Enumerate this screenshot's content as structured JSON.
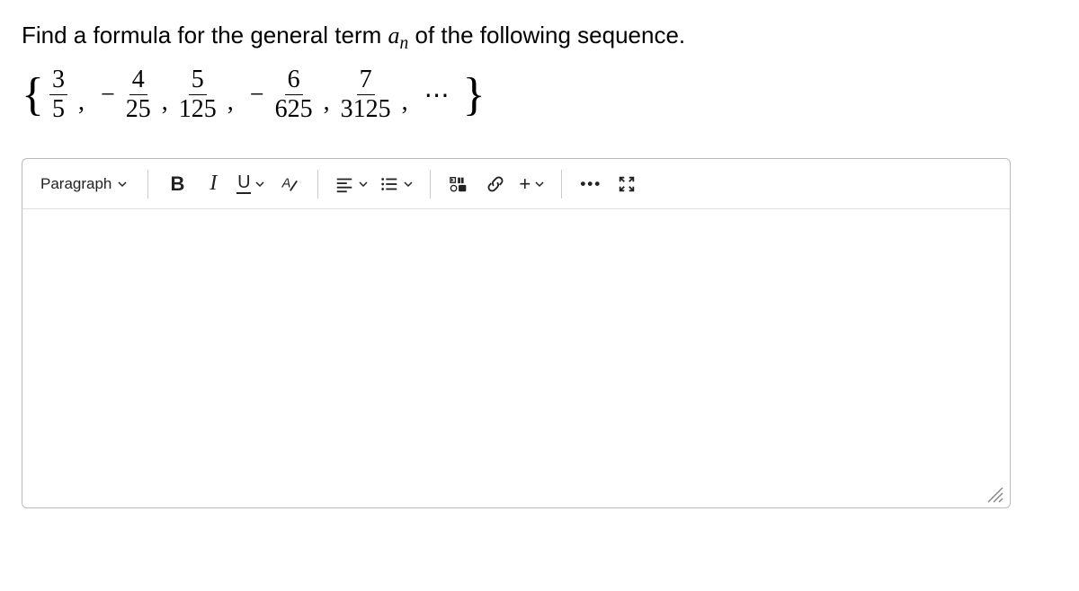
{
  "question": {
    "prefix": "Find a formula for the general term ",
    "var_a": "a",
    "var_n": "n",
    "suffix": " of the following sequence."
  },
  "sequence": {
    "open_brace": "{",
    "terms": [
      {
        "sign": "",
        "num": "3",
        "den": "5"
      },
      {
        "sign": "−",
        "num": "4",
        "den": "25"
      },
      {
        "sign": "",
        "num": "5",
        "den": "125"
      },
      {
        "sign": "−",
        "num": "6",
        "den": "625"
      },
      {
        "sign": "",
        "num": "7",
        "den": "3125"
      }
    ],
    "separator": ",",
    "ellipsis": "⋯",
    "close_brace": "}"
  },
  "toolbar": {
    "paragraph_label": "Paragraph",
    "bold_label": "B",
    "italic_label": "I",
    "underline_label": "U",
    "plus_label": "+",
    "more_label": "•••"
  }
}
